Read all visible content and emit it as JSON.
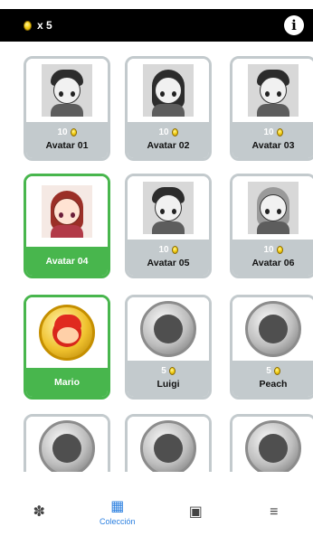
{
  "topbar": {
    "coin_icon": "coin-icon",
    "coin_text": "x 5",
    "info_symbol": "i"
  },
  "cards": [
    {
      "name": "Avatar 01",
      "price": "10",
      "owned": false,
      "art": "boy-grayscale"
    },
    {
      "name": "Avatar 02",
      "price": "10",
      "owned": false,
      "art": "girl-grayscale"
    },
    {
      "name": "Avatar 03",
      "price": "10",
      "owned": false,
      "art": "boy-grayscale"
    },
    {
      "name": "Avatar 04",
      "price": "",
      "owned": true,
      "art": "girl-red-hair"
    },
    {
      "name": "Avatar 05",
      "price": "10",
      "owned": false,
      "art": "boy-grayscale"
    },
    {
      "name": "Avatar 06",
      "price": "10",
      "owned": false,
      "art": "girl-grayscale"
    },
    {
      "name": "Mario",
      "price": "",
      "owned": true,
      "art": "mario-medal"
    },
    {
      "name": "Luigi",
      "price": "5",
      "owned": false,
      "art": "luigi-medal-grayscale"
    },
    {
      "name": "Peach",
      "price": "5",
      "owned": false,
      "art": "peach-medal-grayscale"
    },
    {
      "name": "",
      "price": "",
      "owned": false,
      "art": "donkey-kong-medal-grayscale"
    },
    {
      "name": "",
      "price": "",
      "owned": false,
      "art": "bowser-medal-grayscale"
    },
    {
      "name": "",
      "price": "",
      "owned": false,
      "art": "yoshi-medal-grayscale"
    }
  ],
  "bottom_nav": {
    "items": [
      {
        "icon": "puzzle-icon",
        "glyph": "✽",
        "label": ""
      },
      {
        "icon": "grid-icon",
        "glyph": "▦",
        "label": "Colección"
      },
      {
        "icon": "album-icon",
        "glyph": "▣",
        "label": ""
      },
      {
        "icon": "menu-icon",
        "glyph": "≡",
        "label": ""
      }
    ]
  },
  "colors": {
    "owned_green": "#48b64d",
    "locked_gray": "#c3cacd",
    "active_blue": "#2a7fe0",
    "topbar_black": "#000000"
  }
}
